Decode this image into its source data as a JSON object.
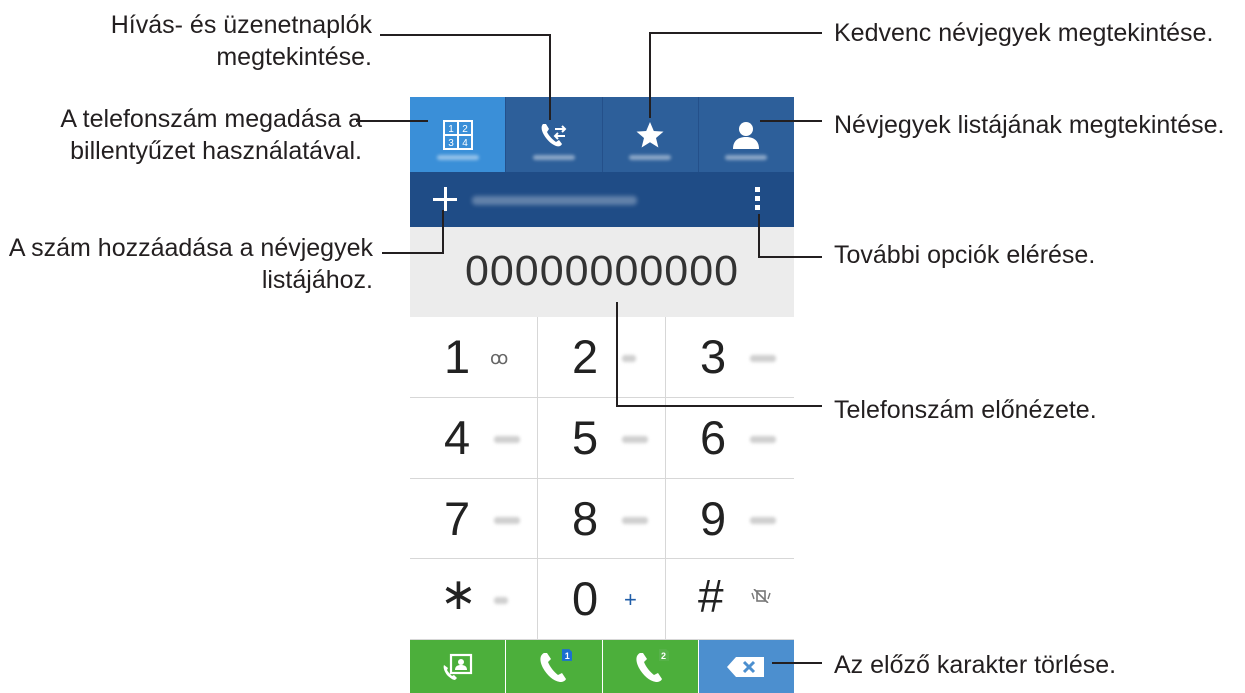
{
  "dialer": {
    "tabs": [
      {
        "name": "keypad-tab",
        "icon": "keypad-icon"
      },
      {
        "name": "logs-tab",
        "icon": "call-log-icon"
      },
      {
        "name": "favourites-tab",
        "icon": "star-icon"
      },
      {
        "name": "contacts-tab",
        "icon": "person-icon"
      }
    ],
    "phone_number": "00000000000",
    "keys": [
      {
        "digit": "1",
        "sub": "ꝏ"
      },
      {
        "digit": "2"
      },
      {
        "digit": "3"
      },
      {
        "digit": "4"
      },
      {
        "digit": "5"
      },
      {
        "digit": "6"
      },
      {
        "digit": "7"
      },
      {
        "digit": "8"
      },
      {
        "digit": "9"
      },
      {
        "digit": "∗"
      },
      {
        "digit": "0",
        "sub": "+"
      },
      {
        "digit": "#"
      }
    ],
    "sim_badges": [
      "1",
      "2"
    ]
  },
  "callouts": {
    "logs": "Hívás- és üzenetnaplók\nmegtekintése.",
    "keypad": "A telefonszám megadása a\nbillentyűzet használatával.",
    "add_contact": "A szám hozzáadása a névjegyek\nlistájához.",
    "favourites": "Kedvenc névjegyek megtekintése.",
    "contacts": "Névjegyek listájának megtekintése.",
    "more": "További opciók elérése.",
    "preview": "Telefonszám előnézete.",
    "delete": "Az előző karakter törlése."
  },
  "colors": {
    "tab_active": "#3a8fd8",
    "tab_bar": "#2d5f9a",
    "number_bar": "#1f4c86",
    "call_green": "#4caf3b",
    "delete_blue": "#4c8fcf"
  }
}
